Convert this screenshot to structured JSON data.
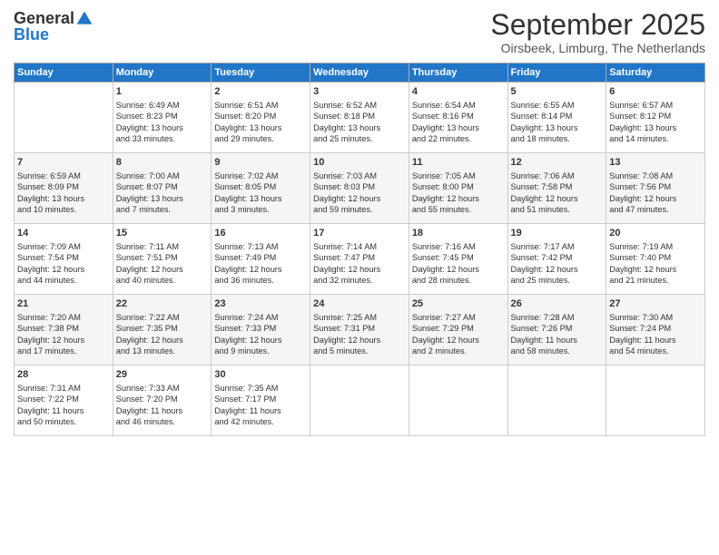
{
  "logo": {
    "general": "General",
    "blue": "Blue"
  },
  "title": "September 2025",
  "subtitle": "Oirsbeek, Limburg, The Netherlands",
  "days_header": [
    "Sunday",
    "Monday",
    "Tuesday",
    "Wednesday",
    "Thursday",
    "Friday",
    "Saturday"
  ],
  "weeks": [
    [
      {
        "num": "",
        "lines": []
      },
      {
        "num": "1",
        "lines": [
          "Sunrise: 6:49 AM",
          "Sunset: 8:23 PM",
          "Daylight: 13 hours",
          "and 33 minutes."
        ]
      },
      {
        "num": "2",
        "lines": [
          "Sunrise: 6:51 AM",
          "Sunset: 8:20 PM",
          "Daylight: 13 hours",
          "and 29 minutes."
        ]
      },
      {
        "num": "3",
        "lines": [
          "Sunrise: 6:52 AM",
          "Sunset: 8:18 PM",
          "Daylight: 13 hours",
          "and 25 minutes."
        ]
      },
      {
        "num": "4",
        "lines": [
          "Sunrise: 6:54 AM",
          "Sunset: 8:16 PM",
          "Daylight: 13 hours",
          "and 22 minutes."
        ]
      },
      {
        "num": "5",
        "lines": [
          "Sunrise: 6:55 AM",
          "Sunset: 8:14 PM",
          "Daylight: 13 hours",
          "and 18 minutes."
        ]
      },
      {
        "num": "6",
        "lines": [
          "Sunrise: 6:57 AM",
          "Sunset: 8:12 PM",
          "Daylight: 13 hours",
          "and 14 minutes."
        ]
      }
    ],
    [
      {
        "num": "7",
        "lines": [
          "Sunrise: 6:59 AM",
          "Sunset: 8:09 PM",
          "Daylight: 13 hours",
          "and 10 minutes."
        ]
      },
      {
        "num": "8",
        "lines": [
          "Sunrise: 7:00 AM",
          "Sunset: 8:07 PM",
          "Daylight: 13 hours",
          "and 7 minutes."
        ]
      },
      {
        "num": "9",
        "lines": [
          "Sunrise: 7:02 AM",
          "Sunset: 8:05 PM",
          "Daylight: 13 hours",
          "and 3 minutes."
        ]
      },
      {
        "num": "10",
        "lines": [
          "Sunrise: 7:03 AM",
          "Sunset: 8:03 PM",
          "Daylight: 12 hours",
          "and 59 minutes."
        ]
      },
      {
        "num": "11",
        "lines": [
          "Sunrise: 7:05 AM",
          "Sunset: 8:00 PM",
          "Daylight: 12 hours",
          "and 55 minutes."
        ]
      },
      {
        "num": "12",
        "lines": [
          "Sunrise: 7:06 AM",
          "Sunset: 7:58 PM",
          "Daylight: 12 hours",
          "and 51 minutes."
        ]
      },
      {
        "num": "13",
        "lines": [
          "Sunrise: 7:08 AM",
          "Sunset: 7:56 PM",
          "Daylight: 12 hours",
          "and 47 minutes."
        ]
      }
    ],
    [
      {
        "num": "14",
        "lines": [
          "Sunrise: 7:09 AM",
          "Sunset: 7:54 PM",
          "Daylight: 12 hours",
          "and 44 minutes."
        ]
      },
      {
        "num": "15",
        "lines": [
          "Sunrise: 7:11 AM",
          "Sunset: 7:51 PM",
          "Daylight: 12 hours",
          "and 40 minutes."
        ]
      },
      {
        "num": "16",
        "lines": [
          "Sunrise: 7:13 AM",
          "Sunset: 7:49 PM",
          "Daylight: 12 hours",
          "and 36 minutes."
        ]
      },
      {
        "num": "17",
        "lines": [
          "Sunrise: 7:14 AM",
          "Sunset: 7:47 PM",
          "Daylight: 12 hours",
          "and 32 minutes."
        ]
      },
      {
        "num": "18",
        "lines": [
          "Sunrise: 7:16 AM",
          "Sunset: 7:45 PM",
          "Daylight: 12 hours",
          "and 28 minutes."
        ]
      },
      {
        "num": "19",
        "lines": [
          "Sunrise: 7:17 AM",
          "Sunset: 7:42 PM",
          "Daylight: 12 hours",
          "and 25 minutes."
        ]
      },
      {
        "num": "20",
        "lines": [
          "Sunrise: 7:19 AM",
          "Sunset: 7:40 PM",
          "Daylight: 12 hours",
          "and 21 minutes."
        ]
      }
    ],
    [
      {
        "num": "21",
        "lines": [
          "Sunrise: 7:20 AM",
          "Sunset: 7:38 PM",
          "Daylight: 12 hours",
          "and 17 minutes."
        ]
      },
      {
        "num": "22",
        "lines": [
          "Sunrise: 7:22 AM",
          "Sunset: 7:35 PM",
          "Daylight: 12 hours",
          "and 13 minutes."
        ]
      },
      {
        "num": "23",
        "lines": [
          "Sunrise: 7:24 AM",
          "Sunset: 7:33 PM",
          "Daylight: 12 hours",
          "and 9 minutes."
        ]
      },
      {
        "num": "24",
        "lines": [
          "Sunrise: 7:25 AM",
          "Sunset: 7:31 PM",
          "Daylight: 12 hours",
          "and 5 minutes."
        ]
      },
      {
        "num": "25",
        "lines": [
          "Sunrise: 7:27 AM",
          "Sunset: 7:29 PM",
          "Daylight: 12 hours",
          "and 2 minutes."
        ]
      },
      {
        "num": "26",
        "lines": [
          "Sunrise: 7:28 AM",
          "Sunset: 7:26 PM",
          "Daylight: 11 hours",
          "and 58 minutes."
        ]
      },
      {
        "num": "27",
        "lines": [
          "Sunrise: 7:30 AM",
          "Sunset: 7:24 PM",
          "Daylight: 11 hours",
          "and 54 minutes."
        ]
      }
    ],
    [
      {
        "num": "28",
        "lines": [
          "Sunrise: 7:31 AM",
          "Sunset: 7:22 PM",
          "Daylight: 11 hours",
          "and 50 minutes."
        ]
      },
      {
        "num": "29",
        "lines": [
          "Sunrise: 7:33 AM",
          "Sunset: 7:20 PM",
          "Daylight: 11 hours",
          "and 46 minutes."
        ]
      },
      {
        "num": "30",
        "lines": [
          "Sunrise: 7:35 AM",
          "Sunset: 7:17 PM",
          "Daylight: 11 hours",
          "and 42 minutes."
        ]
      },
      {
        "num": "",
        "lines": []
      },
      {
        "num": "",
        "lines": []
      },
      {
        "num": "",
        "lines": []
      },
      {
        "num": "",
        "lines": []
      }
    ]
  ]
}
